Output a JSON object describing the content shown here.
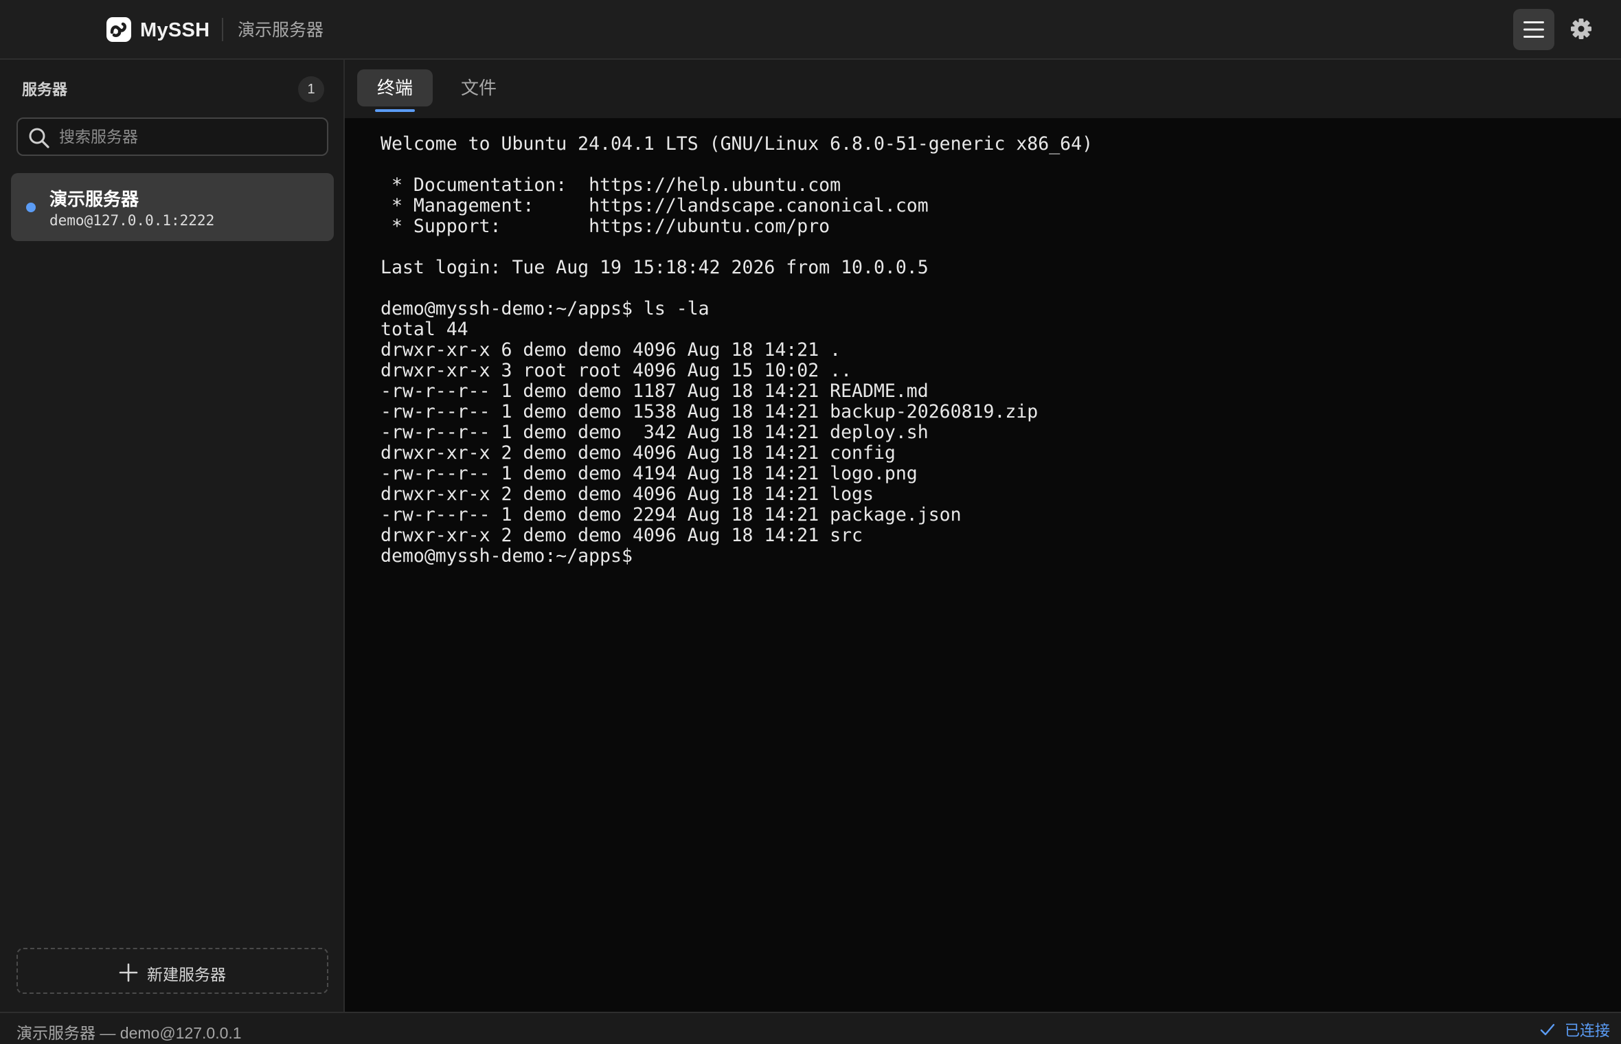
{
  "app": {
    "name": "MySSH",
    "current_server": "演示服务器"
  },
  "colors": {
    "accent": "#5b9cf5",
    "background": "#0a0a0a",
    "sidebar": "#1b1b1b",
    "selected_item": "#3a3a3a"
  },
  "icons": {
    "logo": "link-logo-icon",
    "menu": "hamburger-menu-icon",
    "settings": "gear-icon",
    "search": "search-icon",
    "add": "plus-icon",
    "connected": "check-icon"
  },
  "sidebar": {
    "header": "服务器",
    "count": "1",
    "search_placeholder": "搜索服务器",
    "servers": [
      {
        "name": "演示服务器",
        "address": "demo@127.0.0.1:2222",
        "status": "connected"
      }
    ],
    "new_server_label": "新建服务器"
  },
  "tabs": [
    {
      "label": "终端",
      "active": true
    },
    {
      "label": "文件",
      "active": false
    }
  ],
  "terminal": {
    "lines": [
      "Welcome to Ubuntu 24.04.1 LTS (GNU/Linux 6.8.0-51-generic x86_64)",
      "",
      " * Documentation:  https://help.ubuntu.com",
      " * Management:     https://landscape.canonical.com",
      " * Support:        https://ubuntu.com/pro",
      "",
      "Last login: Tue Aug 19 15:18:42 2026 from 10.0.0.5",
      "",
      "demo@myssh-demo:~/apps$ ls -la",
      "total 44",
      "drwxr-xr-x 6 demo demo 4096 Aug 18 14:21 .",
      "drwxr-xr-x 3 root root 4096 Aug 15 10:02 ..",
      "-rw-r--r-- 1 demo demo 1187 Aug 18 14:21 README.md",
      "-rw-r--r-- 1 demo demo 1538 Aug 18 14:21 backup-20260819.zip",
      "-rw-r--r-- 1 demo demo  342 Aug 18 14:21 deploy.sh",
      "drwxr-xr-x 2 demo demo 4096 Aug 18 14:21 config",
      "-rw-r--r-- 1 demo demo 4194 Aug 18 14:21 logo.png",
      "drwxr-xr-x 2 demo demo 4096 Aug 18 14:21 logs",
      "-rw-r--r-- 1 demo demo 2294 Aug 18 14:21 package.json",
      "drwxr-xr-x 2 demo demo 4096 Aug 18 14:21 src",
      "demo@myssh-demo:~/apps$ "
    ]
  },
  "statusbar": {
    "left": "演示服务器 — demo@127.0.0.1",
    "right": "已连接"
  }
}
